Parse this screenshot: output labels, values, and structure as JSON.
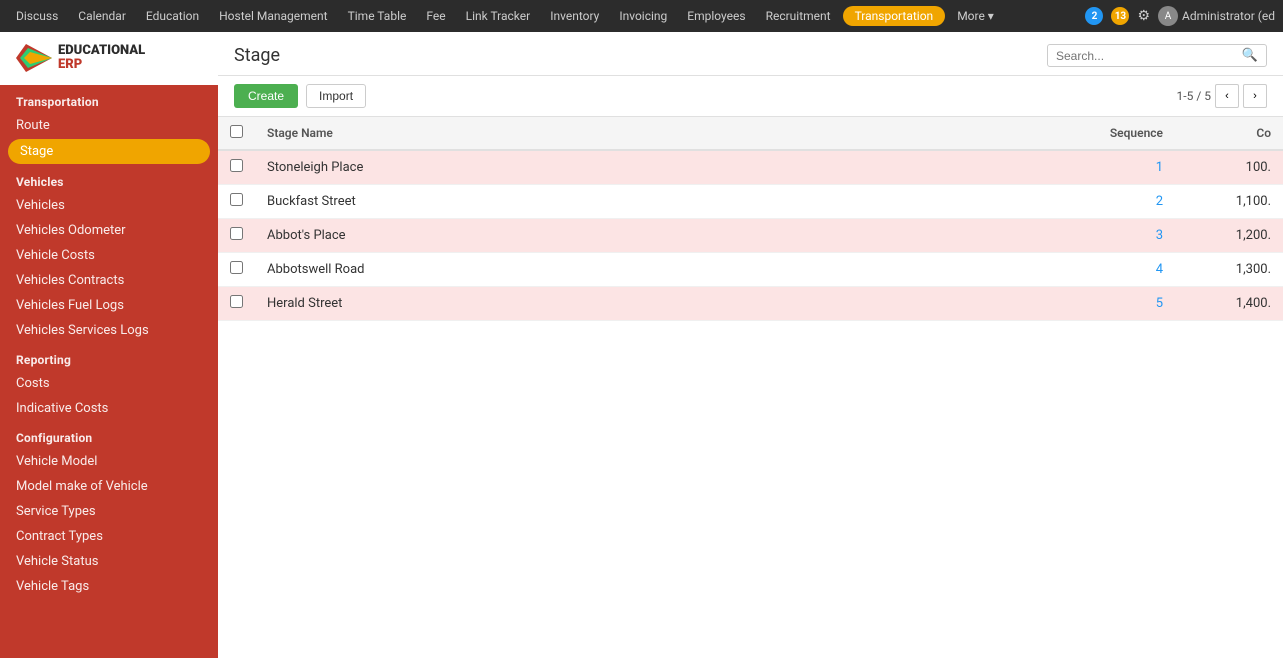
{
  "topNav": {
    "items": [
      {
        "label": "Discuss",
        "active": false
      },
      {
        "label": "Calendar",
        "active": false
      },
      {
        "label": "Education",
        "active": false
      },
      {
        "label": "Hostel Management",
        "active": false
      },
      {
        "label": "Time Table",
        "active": false
      },
      {
        "label": "Fee",
        "active": false
      },
      {
        "label": "Link Tracker",
        "active": false
      },
      {
        "label": "Inventory",
        "active": false
      },
      {
        "label": "Invoicing",
        "active": false
      },
      {
        "label": "Employees",
        "active": false
      },
      {
        "label": "Recruitment",
        "active": false
      },
      {
        "label": "Transportation",
        "active": true
      },
      {
        "label": "More ▾",
        "active": false
      }
    ],
    "badges": [
      {
        "count": "2",
        "color": "blue"
      },
      {
        "count": "13",
        "color": "orange"
      }
    ],
    "admin": "Administrator (ed"
  },
  "logo": {
    "line1": "EDUCATIONAL",
    "line2": "ERP"
  },
  "sidebar": {
    "sectionTransportation": "Transportation",
    "items_transport": [
      {
        "label": "Route",
        "active": false,
        "key": "route"
      },
      {
        "label": "Stage",
        "active": true,
        "key": "stage"
      }
    ],
    "sectionVehicles": "Vehicles",
    "items_vehicles": [
      {
        "label": "Vehicles",
        "key": "vehicles"
      },
      {
        "label": "Vehicles Odometer",
        "key": "vehicles-odometer"
      },
      {
        "label": "Vehicle Costs",
        "key": "vehicle-costs"
      },
      {
        "label": "Vehicles Contracts",
        "key": "vehicles-contracts"
      },
      {
        "label": "Vehicles Fuel Logs",
        "key": "vehicles-fuel-logs"
      },
      {
        "label": "Vehicles Services Logs",
        "key": "vehicles-services-logs"
      }
    ],
    "sectionReporting": "Reporting",
    "items_reporting": [
      {
        "label": "Costs",
        "key": "costs"
      },
      {
        "label": "Indicative Costs",
        "key": "indicative-costs"
      }
    ],
    "sectionConfiguration": "Configuration",
    "items_configuration": [
      {
        "label": "Vehicle Model",
        "key": "vehicle-model"
      },
      {
        "label": "Model make of Vehicle",
        "key": "model-make"
      },
      {
        "label": "Service Types",
        "key": "service-types"
      },
      {
        "label": "Contract Types",
        "key": "contract-types"
      },
      {
        "label": "Vehicle Status",
        "key": "vehicle-status"
      },
      {
        "label": "Vehicle Tags",
        "key": "vehicle-tags"
      }
    ]
  },
  "page": {
    "title": "Stage",
    "searchPlaceholder": "Search...",
    "createLabel": "Create",
    "importLabel": "Import",
    "pagination": "1-5 / 5"
  },
  "table": {
    "headers": [
      {
        "label": "",
        "key": "checkbox"
      },
      {
        "label": "Stage Name",
        "key": "stage-name"
      },
      {
        "label": "Sequence",
        "key": "sequence"
      },
      {
        "label": "Co",
        "key": "co"
      }
    ],
    "rows": [
      {
        "id": 1,
        "name": "Stoneleigh Place",
        "sequence": "1",
        "cost": "100.",
        "pink": true
      },
      {
        "id": 2,
        "name": "Buckfast Street",
        "sequence": "2",
        "cost": "1,100.",
        "pink": false
      },
      {
        "id": 3,
        "name": "Abbot's Place",
        "sequence": "3",
        "cost": "1,200.",
        "pink": true
      },
      {
        "id": 4,
        "name": "Abbotswell Road",
        "sequence": "4",
        "cost": "1,300.",
        "pink": false
      },
      {
        "id": 5,
        "name": "Herald Street",
        "sequence": "5",
        "cost": "1,400.",
        "pink": true
      }
    ]
  }
}
